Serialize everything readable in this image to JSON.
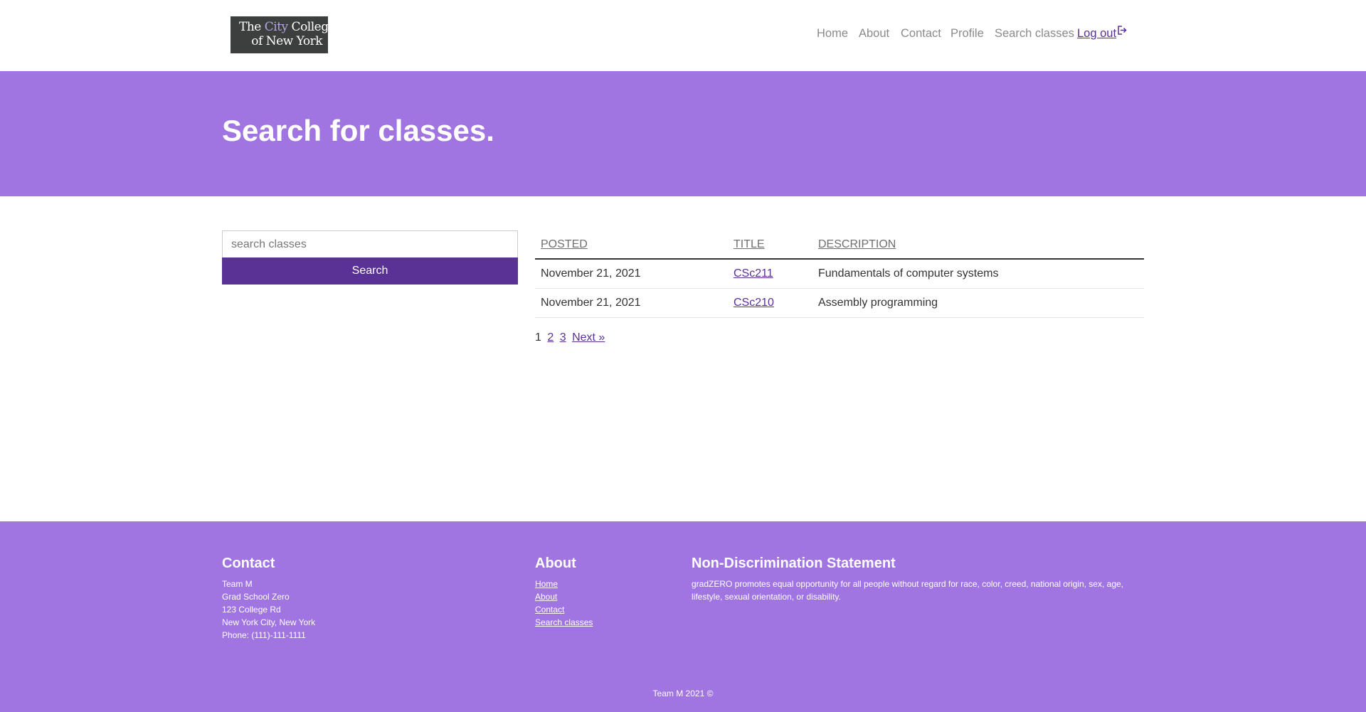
{
  "header": {
    "logo": {
      "line1_pre": "The ",
      "line1_city": "City",
      "line1_post": " College",
      "line2": "of New York"
    },
    "nav": [
      {
        "label": "Home"
      },
      {
        "label": "About"
      },
      {
        "label": "Contact"
      },
      {
        "label": "Profile"
      },
      {
        "label": "Search classes"
      },
      {
        "label": "Log out",
        "icon": "logout-icon"
      }
    ]
  },
  "hero": {
    "title": "Search for classes."
  },
  "search": {
    "placeholder": "search classes",
    "button_label": "Search"
  },
  "table": {
    "columns": [
      "POSTED",
      "TITLE",
      "DESCRIPTION"
    ],
    "rows": [
      {
        "posted": "November 21, 2021",
        "title": "CSc211",
        "description": "Fundamentals of computer systems"
      },
      {
        "posted": "November 21, 2021",
        "title": "CSc210",
        "description": "Assembly programming"
      }
    ]
  },
  "pagination": {
    "current": "1",
    "pages": [
      "2",
      "3"
    ],
    "next": "Next »"
  },
  "footer": {
    "contact": {
      "heading": "Contact",
      "lines": [
        "Team M",
        "Grad School Zero",
        "123 College Rd",
        "New York City, New York",
        "Phone: (111)-111-1111"
      ]
    },
    "about": {
      "heading": "About",
      "links": [
        "Home",
        "About",
        "Contact",
        "Search classes"
      ]
    },
    "statement": {
      "heading": "Non-Discrimination Statement",
      "text": "gradZERO promotes equal opportunity for all people without regard for race, color, creed, national origin, sex, age, lifestyle, sexual orientation, or disability."
    },
    "copyright": "Team M 2021 ©"
  },
  "colors": {
    "brand_purple": "#a075e1",
    "button_purple": "#5a3296",
    "link_purple": "#5b2f96"
  }
}
